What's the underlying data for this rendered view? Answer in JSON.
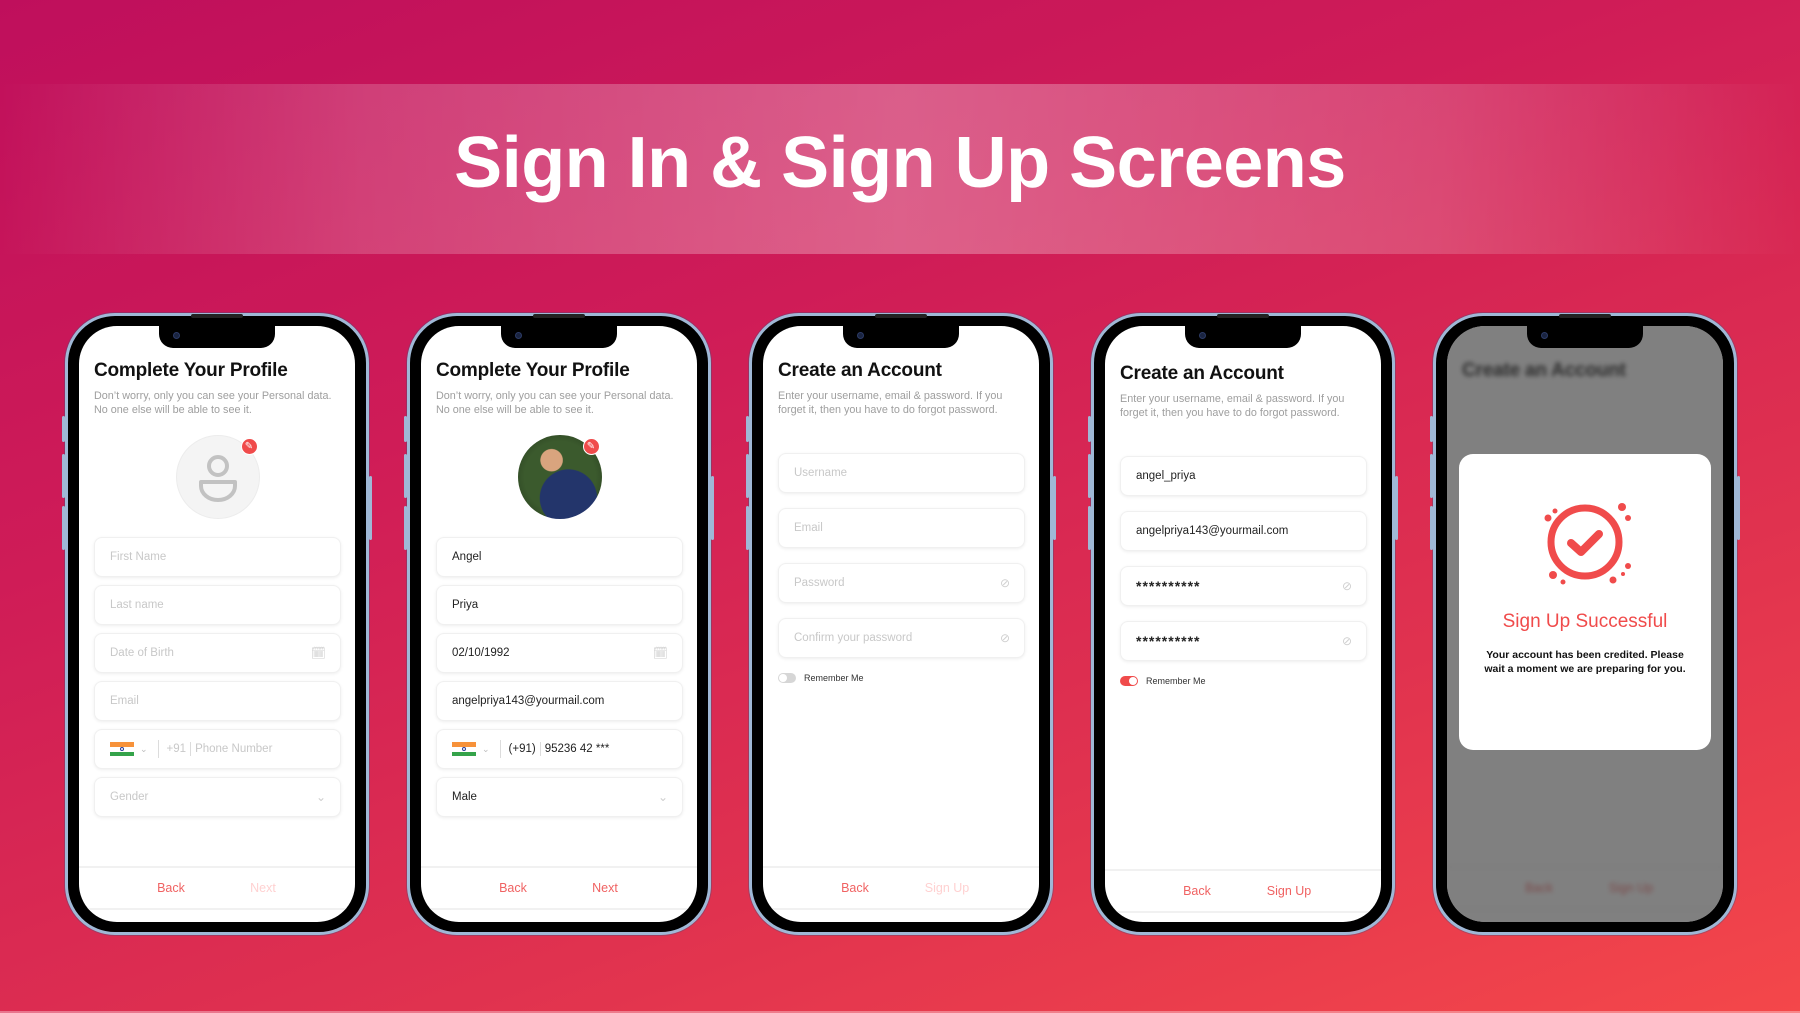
{
  "banner": {
    "title": "Sign In & Sign Up Screens"
  },
  "colors": {
    "accent": "#f04b4b",
    "background_start": "#bf0f5c",
    "background_end": "#f4474a",
    "frame": "#9fb8d6"
  },
  "phones": [
    {
      "title": "Complete Your Profile",
      "subtitle": "Don’t worry, only you can see your Personal data. No one else will be able to see it.",
      "avatar": "person-placeholder-icon",
      "fields": {
        "first_name": "First Name",
        "last_name": "Last name",
        "dob": "Date of Birth",
        "email": "Email",
        "country_code": "+91",
        "phone": "Phone Number",
        "gender": "Gender"
      },
      "footer": {
        "back": "Back",
        "next": "Next"
      }
    },
    {
      "title": "Complete Your Profile",
      "subtitle": "Don’t worry, only you can see your Personal data. No one else will be able to see it.",
      "avatar": "profile-photo",
      "fields": {
        "first_name": "Angel",
        "last_name": "Priya",
        "dob": "02/10/1992",
        "email": "angelpriya143@yourmail.com",
        "country_code": "(+91)",
        "phone": "95236 42 ***",
        "gender": "Male"
      },
      "footer": {
        "back": "Back",
        "next": "Next"
      }
    },
    {
      "title": "Create an Account",
      "subtitle": "Enter your username, email & password. If you forget it, then you have to do forgot password.",
      "fields": {
        "username": "Username",
        "email": "Email",
        "password": "Password",
        "confirm": "Confirm your password"
      },
      "remember_label": "Remember Me",
      "remember_on": false,
      "footer": {
        "back": "Back",
        "next": "Sign Up"
      }
    },
    {
      "title": "Create an Account",
      "subtitle": "Enter your username, email & password. If you forget it, then you have to do forgot password.",
      "fields": {
        "username": "angel_priya",
        "email": "angelpriya143@yourmail.com",
        "password": "**********",
        "confirm": "**********"
      },
      "remember_label": "Remember Me",
      "remember_on": true,
      "footer": {
        "back": "Back",
        "next": "Sign Up"
      }
    },
    {
      "title": "Create an Account",
      "modal": {
        "icon": "check-circle-icon",
        "title": "Sign Up Successful",
        "text": "Your account has been credited. Please wait a moment we are preparing for you."
      },
      "footer": {
        "back": "Back",
        "next": "Sign Up"
      }
    }
  ]
}
